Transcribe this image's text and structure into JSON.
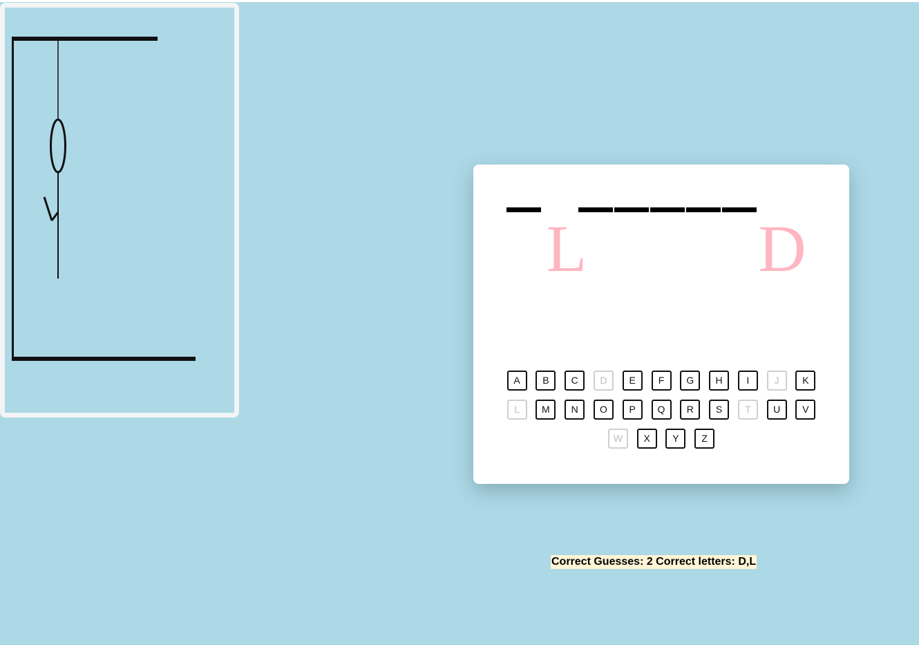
{
  "word": {
    "slots": [
      {
        "dash": true,
        "letter": ""
      },
      {
        "dash": false,
        "letter": "L"
      },
      {
        "dash": true,
        "letter": ""
      },
      {
        "dash": true,
        "letter": ""
      },
      {
        "dash": true,
        "letter": ""
      },
      {
        "dash": true,
        "letter": ""
      },
      {
        "dash": true,
        "letter": ""
      },
      {
        "dash": false,
        "letter": "D"
      }
    ]
  },
  "keyboard": {
    "rows": [
      [
        {
          "label": "A",
          "used": false
        },
        {
          "label": "B",
          "used": false
        },
        {
          "label": "C",
          "used": false
        },
        {
          "label": "D",
          "used": true
        },
        {
          "label": "E",
          "used": false
        },
        {
          "label": "F",
          "used": false
        },
        {
          "label": "G",
          "used": false
        },
        {
          "label": "H",
          "used": false
        },
        {
          "label": "I",
          "used": false
        },
        {
          "label": "J",
          "used": true
        },
        {
          "label": "K",
          "used": false
        }
      ],
      [
        {
          "label": "L",
          "used": true
        },
        {
          "label": "M",
          "used": false
        },
        {
          "label": "N",
          "used": false
        },
        {
          "label": "O",
          "used": false
        },
        {
          "label": "P",
          "used": false
        },
        {
          "label": "Q",
          "used": false
        },
        {
          "label": "R",
          "used": false
        },
        {
          "label": "S",
          "used": false
        },
        {
          "label": "T",
          "used": true
        },
        {
          "label": "U",
          "used": false
        },
        {
          "label": "V",
          "used": false
        }
      ],
      [
        {
          "label": "W",
          "used": true
        },
        {
          "label": "X",
          "used": false
        },
        {
          "label": "Y",
          "used": false
        },
        {
          "label": "Z",
          "used": false
        }
      ]
    ]
  },
  "status": {
    "text": "Correct Guesses: 2 Correct letters: D,L"
  },
  "hangman": {
    "parts_shown": [
      "gallows",
      "rope",
      "head",
      "body",
      "left-arm"
    ]
  },
  "colors": {
    "background": "#add8e6",
    "revealed_letter": "#ffb6c1",
    "card": "#ffffff",
    "status_highlight": "#fff5d6"
  }
}
